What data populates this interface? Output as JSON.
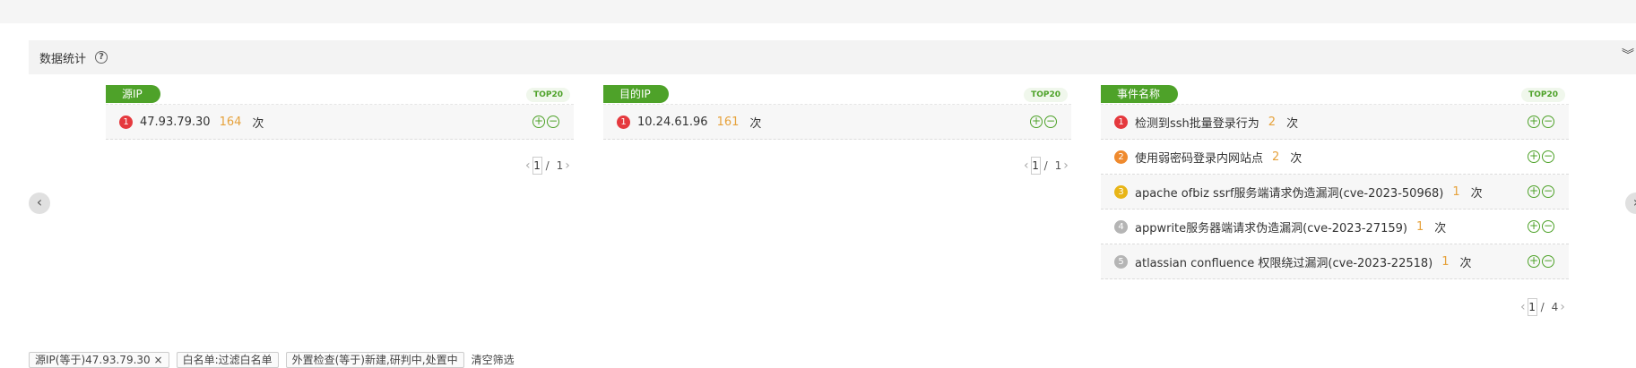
{
  "section": {
    "title": "数据统计",
    "help_icon": "?",
    "collapse_icon": "︾"
  },
  "nav": {
    "prev": "‹",
    "next": "›"
  },
  "top_badge": "TOP20",
  "panels": [
    {
      "title": "源IP",
      "rows": [
        {
          "rank": "1",
          "label": "47.93.79.30",
          "count": "164",
          "unit": "次"
        }
      ],
      "pager": {
        "current": "1",
        "total": "1",
        "sep": "/"
      }
    },
    {
      "title": "目的IP",
      "rows": [
        {
          "rank": "1",
          "label": "10.24.61.96",
          "count": "161",
          "unit": "次"
        }
      ],
      "pager": {
        "current": "1",
        "total": "1",
        "sep": "/"
      }
    },
    {
      "title": "事件名称",
      "rows": [
        {
          "rank": "1",
          "label": "检测到ssh批量登录行为",
          "count": "2",
          "unit": "次"
        },
        {
          "rank": "2",
          "label": "使用弱密码登录内网站点",
          "count": "2",
          "unit": "次"
        },
        {
          "rank": "3",
          "label": "apache ofbiz ssrf服务端请求伪造漏洞(cve-2023-50968)",
          "count": "1",
          "unit": "次"
        },
        {
          "rank": "4",
          "label": "appwrite服务器端请求伪造漏洞(cve-2023-27159)",
          "count": "1",
          "unit": "次"
        },
        {
          "rank": "5",
          "label": "atlassian confluence 权限绕过漏洞(cve-2023-22518)",
          "count": "1",
          "unit": "次"
        }
      ],
      "pager": {
        "current": "1",
        "total": "4",
        "sep": "/"
      }
    }
  ],
  "actions": {
    "add": "+",
    "remove": "−"
  },
  "rank_colors": [
    "#e5393e",
    "#ef8a2e",
    "#e8b517",
    "#b5b5b5",
    "#b5b5b5"
  ],
  "filters": [
    {
      "label": "源IP(等于)47.93.79.30",
      "close": "×"
    },
    {
      "label": "白名单:过滤白名单"
    },
    {
      "label": "外置检查(等于)新建,研判中,处置中"
    }
  ],
  "clear_filters": "清空筛选"
}
